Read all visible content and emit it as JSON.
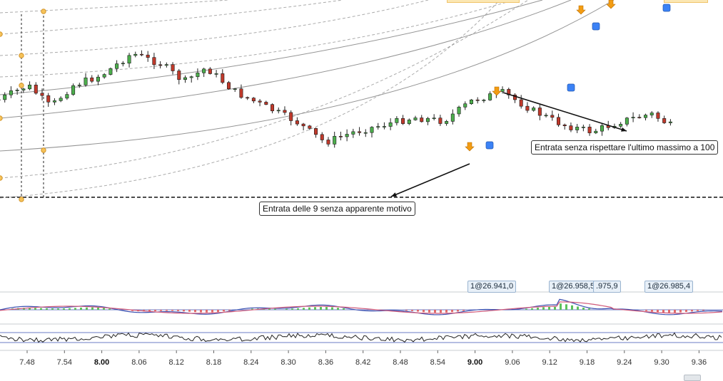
{
  "chart_data": {
    "type": "candlestick",
    "x_tick_labels": [
      "7.48",
      "7.54",
      "8.00",
      "8.06",
      "8.12",
      "8.18",
      "8.24",
      "8.30",
      "8.36",
      "8.42",
      "8.48",
      "8.54",
      "9.00",
      "9.06",
      "9.12",
      "9.18",
      "9.24",
      "9.30",
      "9.36"
    ],
    "x_tick_major": [
      "8.00",
      "9.00"
    ],
    "reference_line": {
      "style": "dashed"
    },
    "annotations": [
      {
        "text": "Entrata delle 9 senza apparente motivo"
      },
      {
        "text": "Entrata senza rispettare l'ultimo massimo a 100"
      }
    ],
    "fills": [
      {
        "text": "1@26.941,0"
      },
      {
        "text": "1@26.958,5"
      },
      {
        "text": ".975,9"
      },
      {
        "text": "1@26.985,4"
      }
    ],
    "colors": {
      "bull": "#4cae4c",
      "bear": "#c0392b",
      "wick": "#222222",
      "entry_marker": "#f39c12",
      "exit_marker": "#3b82f6",
      "macd_line": "#3a4fb0",
      "signal_line": "#d05a7a",
      "hist_pos": "#5cc05c",
      "hist_neg": "#e06a6a",
      "osc_line": "#222222",
      "arc": "#888888"
    }
  }
}
